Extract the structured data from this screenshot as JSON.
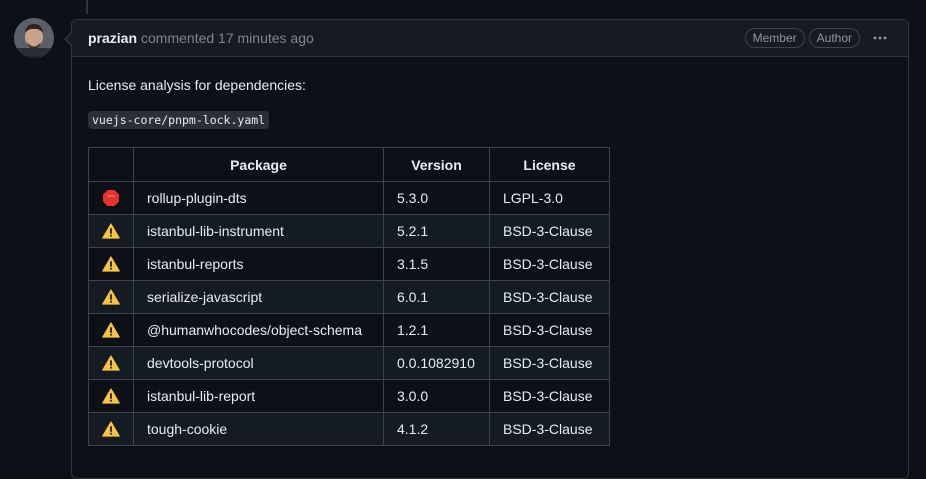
{
  "comment": {
    "author": "prazian",
    "meta": "commented 17 minutes ago",
    "badges": [
      "Member",
      "Author"
    ],
    "intro": "License analysis for dependencies:",
    "lockfile": "vuejs-core/pnpm-lock.yaml"
  },
  "table": {
    "headers": [
      "",
      "Package",
      "Version",
      "License"
    ],
    "rows": [
      {
        "status": "stop-icon",
        "package": "rollup-plugin-dts",
        "version": "5.3.0",
        "license": "LGPL-3.0"
      },
      {
        "status": "warning-icon",
        "package": "istanbul-lib-instrument",
        "version": "5.2.1",
        "license": "BSD-3-Clause"
      },
      {
        "status": "warning-icon",
        "package": "istanbul-reports",
        "version": "3.1.5",
        "license": "BSD-3-Clause"
      },
      {
        "status": "warning-icon",
        "package": "serialize-javascript",
        "version": "6.0.1",
        "license": "BSD-3-Clause"
      },
      {
        "status": "warning-icon",
        "package": "@humanwhocodes/object-schema",
        "version": "1.2.1",
        "license": "BSD-3-Clause"
      },
      {
        "status": "warning-icon",
        "package": "devtools-protocol",
        "version": "0.0.1082910",
        "license": "BSD-3-Clause"
      },
      {
        "status": "warning-icon",
        "package": "istanbul-lib-report",
        "version": "3.0.0",
        "license": "BSD-3-Clause"
      },
      {
        "status": "warning-icon",
        "package": "tough-cookie",
        "version": "4.1.2",
        "license": "BSD-3-Clause"
      }
    ]
  },
  "colors": {
    "background": "#0d1117",
    "border": "#30363d",
    "stop": "#e5322d",
    "warning": "#f6c343"
  }
}
